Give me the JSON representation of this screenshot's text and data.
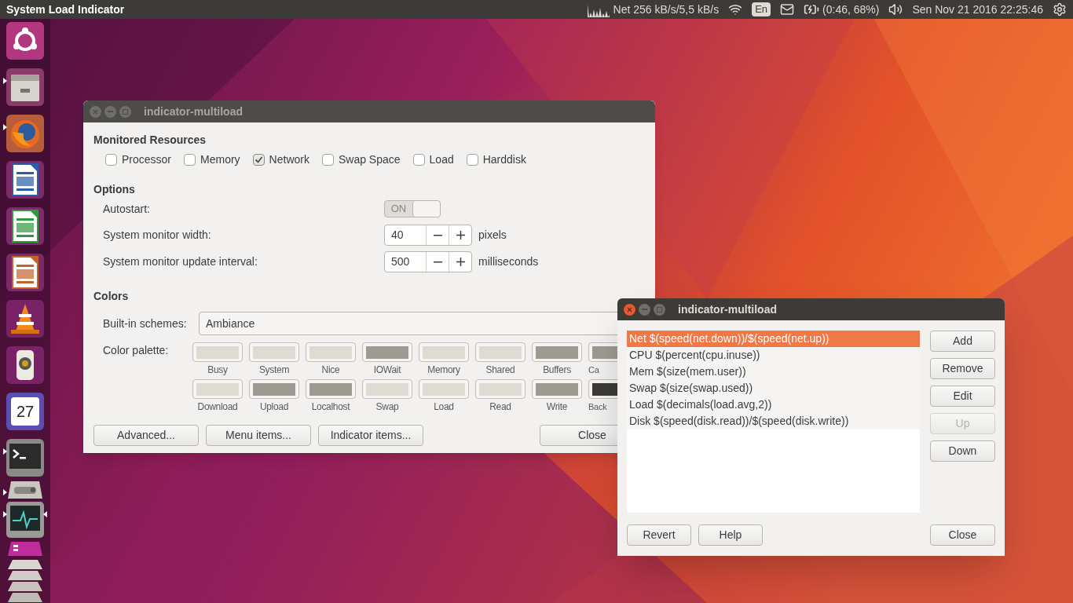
{
  "top_panel": {
    "app_title": "System Load Indicator",
    "net_label": "Net 256 kB/s/5,5 kB/s",
    "keyboard": "En",
    "battery": "(0:46, 68%)",
    "clock": "Sen Nov 21 2016 22:25:46"
  },
  "launcher": [
    {
      "kind": "ubuntu",
      "running": false,
      "focused": false
    },
    {
      "kind": "files",
      "running": true,
      "focused": false
    },
    {
      "kind": "firefox",
      "running": true,
      "focused": false
    },
    {
      "kind": "writer",
      "running": false,
      "focused": false
    },
    {
      "kind": "calc",
      "running": false,
      "focused": false
    },
    {
      "kind": "impress",
      "running": false,
      "focused": false
    },
    {
      "kind": "vlc",
      "running": false,
      "focused": false
    },
    {
      "kind": "speaker",
      "running": false,
      "focused": false
    },
    {
      "kind": "calendar",
      "running": false,
      "focused": false,
      "text": "27"
    },
    {
      "kind": "terminal",
      "running": true,
      "focused": false
    },
    {
      "kind": "drive",
      "running": true,
      "focused": false
    },
    {
      "kind": "monitor",
      "running": true,
      "focused": true
    },
    {
      "kind": "workspaces",
      "running": false,
      "focused": false
    },
    {
      "kind": "stack",
      "running": false,
      "focused": false
    }
  ],
  "preferences_window": {
    "title": "indicator-multiload",
    "active": false,
    "resources": {
      "title": "Monitored Resources",
      "items": [
        {
          "label": "Processor",
          "checked": false
        },
        {
          "label": "Memory",
          "checked": false
        },
        {
          "label": "Network",
          "checked": true
        },
        {
          "label": "Swap Space",
          "checked": false
        },
        {
          "label": "Load",
          "checked": false
        },
        {
          "label": "Harddisk",
          "checked": false
        }
      ]
    },
    "options": {
      "title": "Options",
      "autostart": {
        "label": "Autostart:",
        "on": true,
        "text": "ON"
      },
      "spins": [
        {
          "label": "System monitor width:",
          "value": "40",
          "unit": "pixels"
        },
        {
          "label": "System monitor update interval:",
          "value": "500",
          "unit": "milliseconds"
        }
      ]
    },
    "colors": {
      "title": "Colors",
      "scheme_label": "Built-in schemes:",
      "scheme_value": "Ambiance",
      "palette_label": "Color palette:",
      "rows": [
        [
          {
            "label": "Busy",
            "color": "#dfdbd2"
          },
          {
            "label": "System",
            "color": "#dfdbd2"
          },
          {
            "label": "Nice",
            "color": "#dfdbd2"
          },
          {
            "label": "IOWait",
            "color": "#9d9a91"
          },
          {
            "label": "Memory",
            "color": "#dfdbd2"
          },
          {
            "label": "Shared",
            "color": "#dfdbd2"
          },
          {
            "label": "Buffers",
            "color": "#9d9a91"
          },
          {
            "label": "Ca",
            "color": "#9d9a91"
          }
        ],
        [
          {
            "label": "Download",
            "color": "#dfdbd2"
          },
          {
            "label": "Upload",
            "color": "#9d9a91"
          },
          {
            "label": "Localhost",
            "color": "#9d9a91"
          },
          {
            "label": "Swap",
            "color": "#dfdbd2"
          },
          {
            "label": "Load",
            "color": "#dfdbd2"
          },
          {
            "label": "Read",
            "color": "#dfdbd2"
          },
          {
            "label": "Write",
            "color": "#9d9a91"
          },
          {
            "label": "Back",
            "color": "#3c3b37"
          }
        ]
      ]
    },
    "buttons": [
      "Advanced...",
      "Menu items...",
      "Indicator items..."
    ],
    "close": "Close"
  },
  "items_window": {
    "title": "indicator-multiload",
    "active": true,
    "list": [
      {
        "text": "Net $(speed(net.down))/$(speed(net.up))",
        "selected": true
      },
      {
        "text": "CPU $(percent(cpu.inuse))",
        "selected": false
      },
      {
        "text": "Mem $(size(mem.user))",
        "selected": false
      },
      {
        "text": "Swap $(size(swap.used))",
        "selected": false
      },
      {
        "text": "Load $(decimals(load.avg,2))",
        "selected": false
      },
      {
        "text": "Disk $(speed(disk.read))/$(speed(disk.write))",
        "selected": false
      }
    ],
    "side_buttons": [
      {
        "label": "Add",
        "disabled": false
      },
      {
        "label": "Remove",
        "disabled": false
      },
      {
        "label": "Edit",
        "disabled": false
      },
      {
        "label": "Up",
        "disabled": true
      },
      {
        "label": "Down",
        "disabled": false
      }
    ],
    "bottom_buttons": [
      "Revert",
      "Help"
    ],
    "close": "Close"
  }
}
